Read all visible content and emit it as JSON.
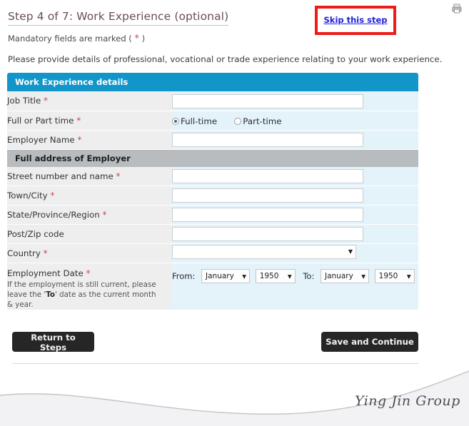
{
  "header": {
    "title": "Step 4 of 7: Work Experience (optional)",
    "skip_link": "Skip this step",
    "mandatory_prefix": "Mandatory fields are marked ( ",
    "mandatory_star": "*",
    "mandatory_suffix": " )",
    "intro": "Please provide details of professional, vocational or trade experience relating to your work experience.",
    "print_icon": "printer-icon",
    "highlight_color": "#ee1b17",
    "link_color": "#2121d8"
  },
  "form": {
    "section_blue": "Work Experience details",
    "section_grey": "Full address of Employer",
    "blue_header_color": "#1295c9",
    "grey_header_color": "#b8bcbe",
    "label_bg": "#eeeeee",
    "value_bg": "#e4f3fa",
    "required_marker": "*",
    "rows": [
      {
        "label": "Job Title",
        "required": true,
        "type": "text",
        "value": ""
      },
      {
        "label": "Full or Part time",
        "required": true,
        "type": "radio",
        "value": "Full-time"
      },
      {
        "label": "Employer Name",
        "required": true,
        "type": "text",
        "value": ""
      },
      {
        "label": "Street number and name",
        "required": true,
        "type": "text",
        "value": ""
      },
      {
        "label": "Town/City",
        "required": true,
        "type": "text",
        "value": ""
      },
      {
        "label": "State/Province/Region",
        "required": true,
        "type": "text",
        "value": ""
      },
      {
        "label": "Post/Zip code",
        "required": false,
        "type": "text",
        "value": ""
      },
      {
        "label": "Country",
        "required": true,
        "type": "select",
        "value": ""
      }
    ],
    "radio_options": [
      {
        "label": "Full-time",
        "selected": true
      },
      {
        "label": "Part-time",
        "selected": false
      }
    ],
    "employment": {
      "label": "Employment Date",
      "required": true,
      "help_part1": "If the employment is still current, please leave the '",
      "help_bold": "To",
      "help_part2": "' date as the current month & year.",
      "from_label": "From:",
      "to_label": "To:",
      "from_month": "January",
      "from_year": "1950",
      "to_month": "January",
      "to_year": "1950"
    }
  },
  "actions": {
    "return_label": "Return to Steps",
    "save_label": "Save and Continue"
  },
  "footer": {
    "brand": "Ying Jin Group"
  }
}
